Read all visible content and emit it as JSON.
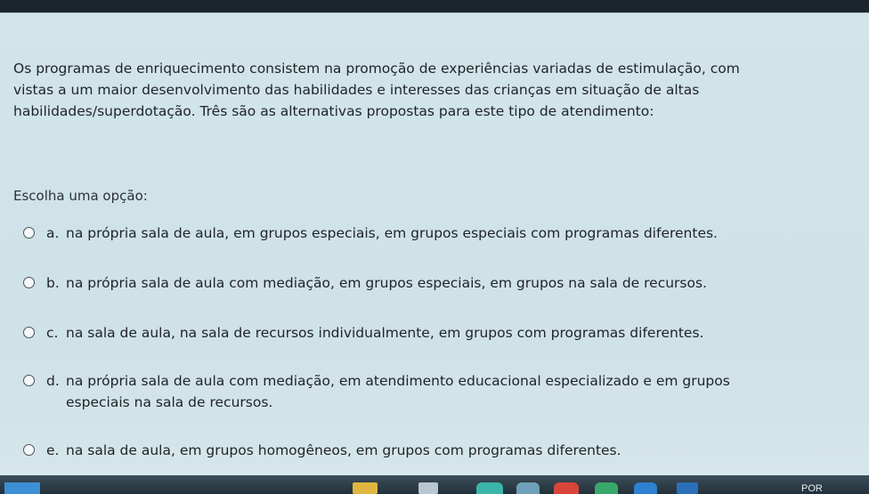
{
  "question": {
    "lines": [
      "Os programas de enriquecimento consistem na promoção de experiências variadas de estimulação, com",
      "vistas a um maior desenvolvimento das habilidades e interesses das crianças em situação de altas",
      "habilidades/superdotação. Três são as alternativas propostas para este tipo de atendimento:"
    ]
  },
  "prompt": "Escolha uma opção:",
  "options": [
    {
      "letter": "a.",
      "text": "na própria sala de aula, em grupos especiais, em grupos especiais com programas diferentes."
    },
    {
      "letter": "b.",
      "text": "na própria sala de aula com mediação, em grupos especiais, em grupos na sala de recursos."
    },
    {
      "letter": "c.",
      "text": "na sala de aula, na sala de recursos individualmente, em grupos com programas diferentes."
    },
    {
      "letter": "d.",
      "text": "na própria sala de aula com mediação, em atendimento educacional especializado e em grupos especiais na sala de recursos."
    },
    {
      "letter": "e.",
      "text": "na sala de aula, em grupos homogêneos, em grupos com programas diferentes."
    }
  ],
  "taskbar": {
    "language": "POR"
  }
}
